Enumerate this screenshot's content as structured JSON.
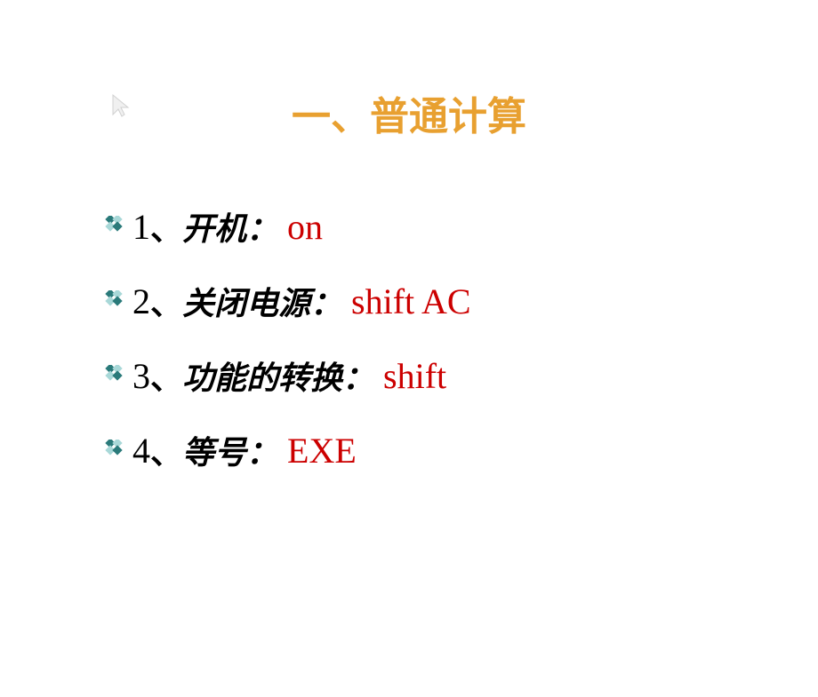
{
  "title": "一、普通计算",
  "items": [
    {
      "num": "1",
      "sep": "、",
      "label": "开机：",
      "value": "on"
    },
    {
      "num": "2",
      "sep": "、",
      "label": "关闭电源：",
      "value": "shift AC"
    },
    {
      "num": "3",
      "sep": "、",
      "label": "功能的转换：",
      "value": " shift"
    },
    {
      "num": "4",
      "sep": "、",
      "label": "等号：",
      "value": "EXE"
    }
  ]
}
